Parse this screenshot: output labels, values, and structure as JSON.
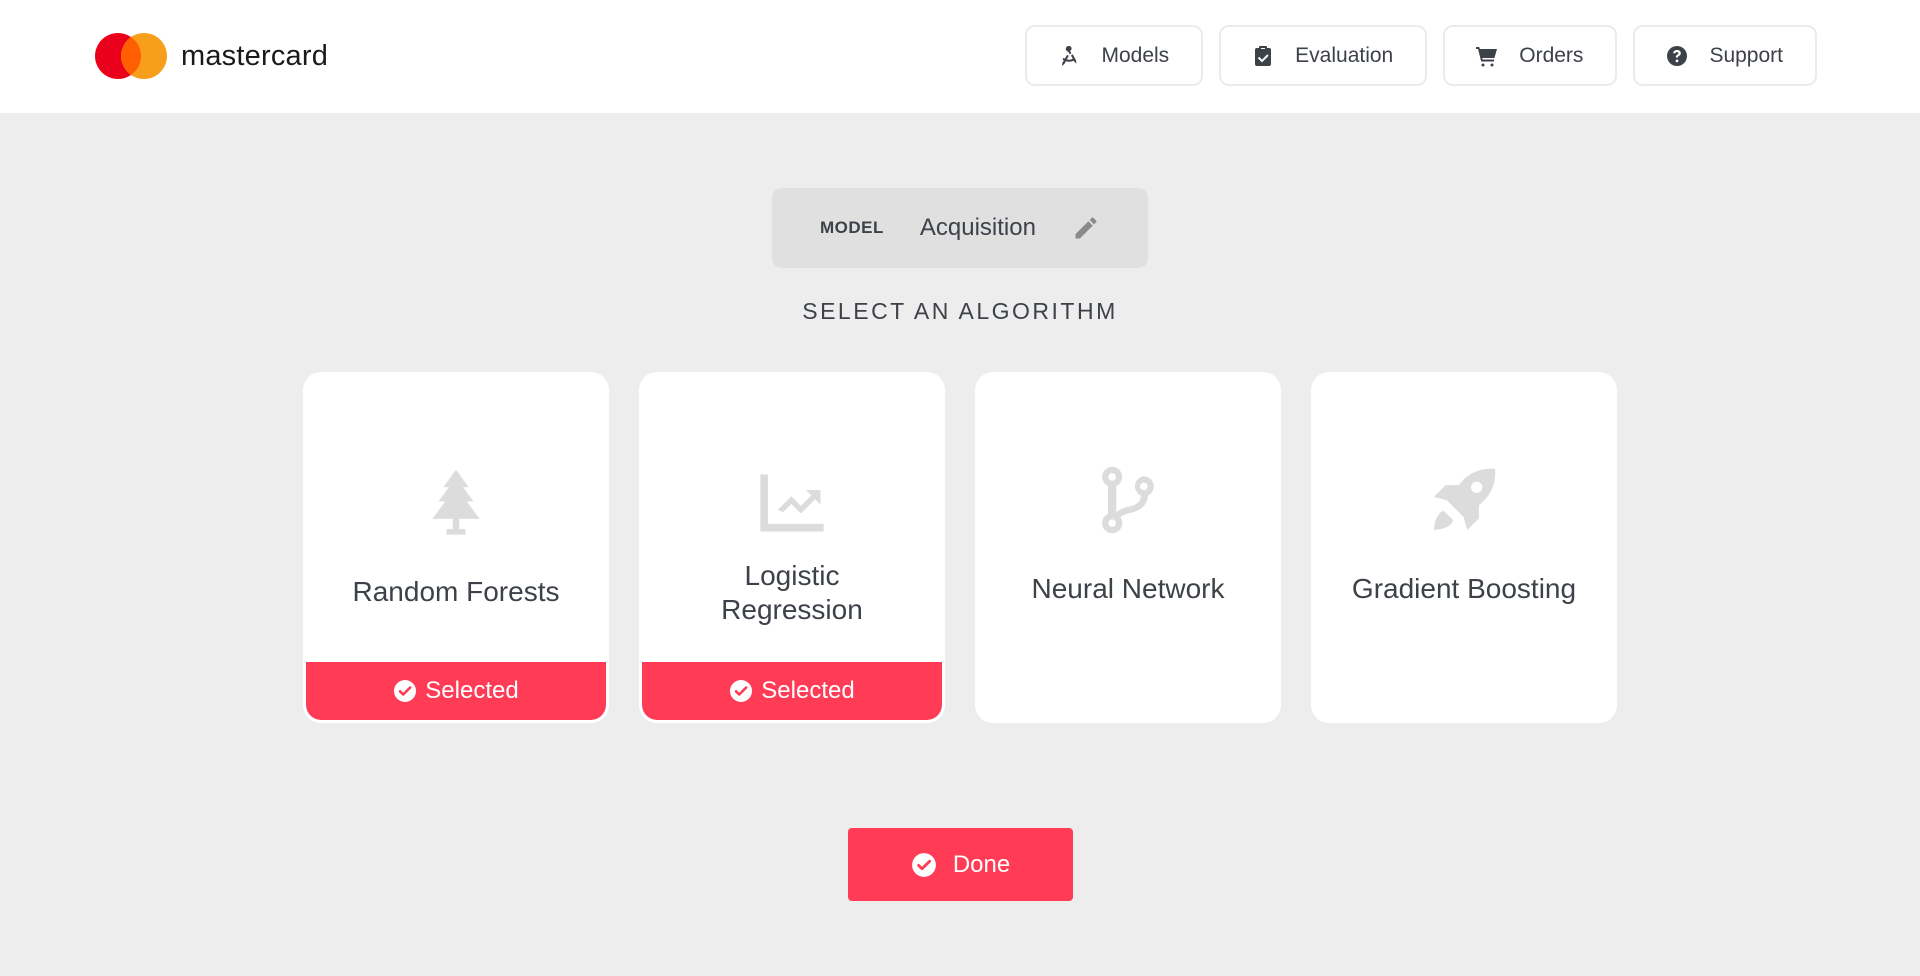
{
  "header": {
    "brand": "mastercard",
    "nav": [
      {
        "label": "Models",
        "icon": "compass-drafting-icon"
      },
      {
        "label": "Evaluation",
        "icon": "clipboard-check-icon"
      },
      {
        "label": "Orders",
        "icon": "cart-icon"
      },
      {
        "label": "Support",
        "icon": "question-circle-icon"
      }
    ]
  },
  "model": {
    "tag": "MODEL",
    "name": "Acquisition"
  },
  "section_title": "SELECT AN ALGORITHM",
  "algorithms": [
    {
      "label": "Random Forests",
      "icon": "tree-icon",
      "selected": true,
      "selected_label": "Selected"
    },
    {
      "label_line1": "Logistic",
      "label_line2": "Regression",
      "icon": "chart-line-icon",
      "selected": true,
      "selected_label": "Selected"
    },
    {
      "label": "Neural Network",
      "icon": "code-branch-icon",
      "selected": false
    },
    {
      "label": "Gradient Boosting",
      "icon": "rocket-icon",
      "selected": false
    }
  ],
  "done_label": "Done",
  "colors": {
    "accent": "#ff3b56",
    "background": "#ededed",
    "text": "#3d4148"
  }
}
